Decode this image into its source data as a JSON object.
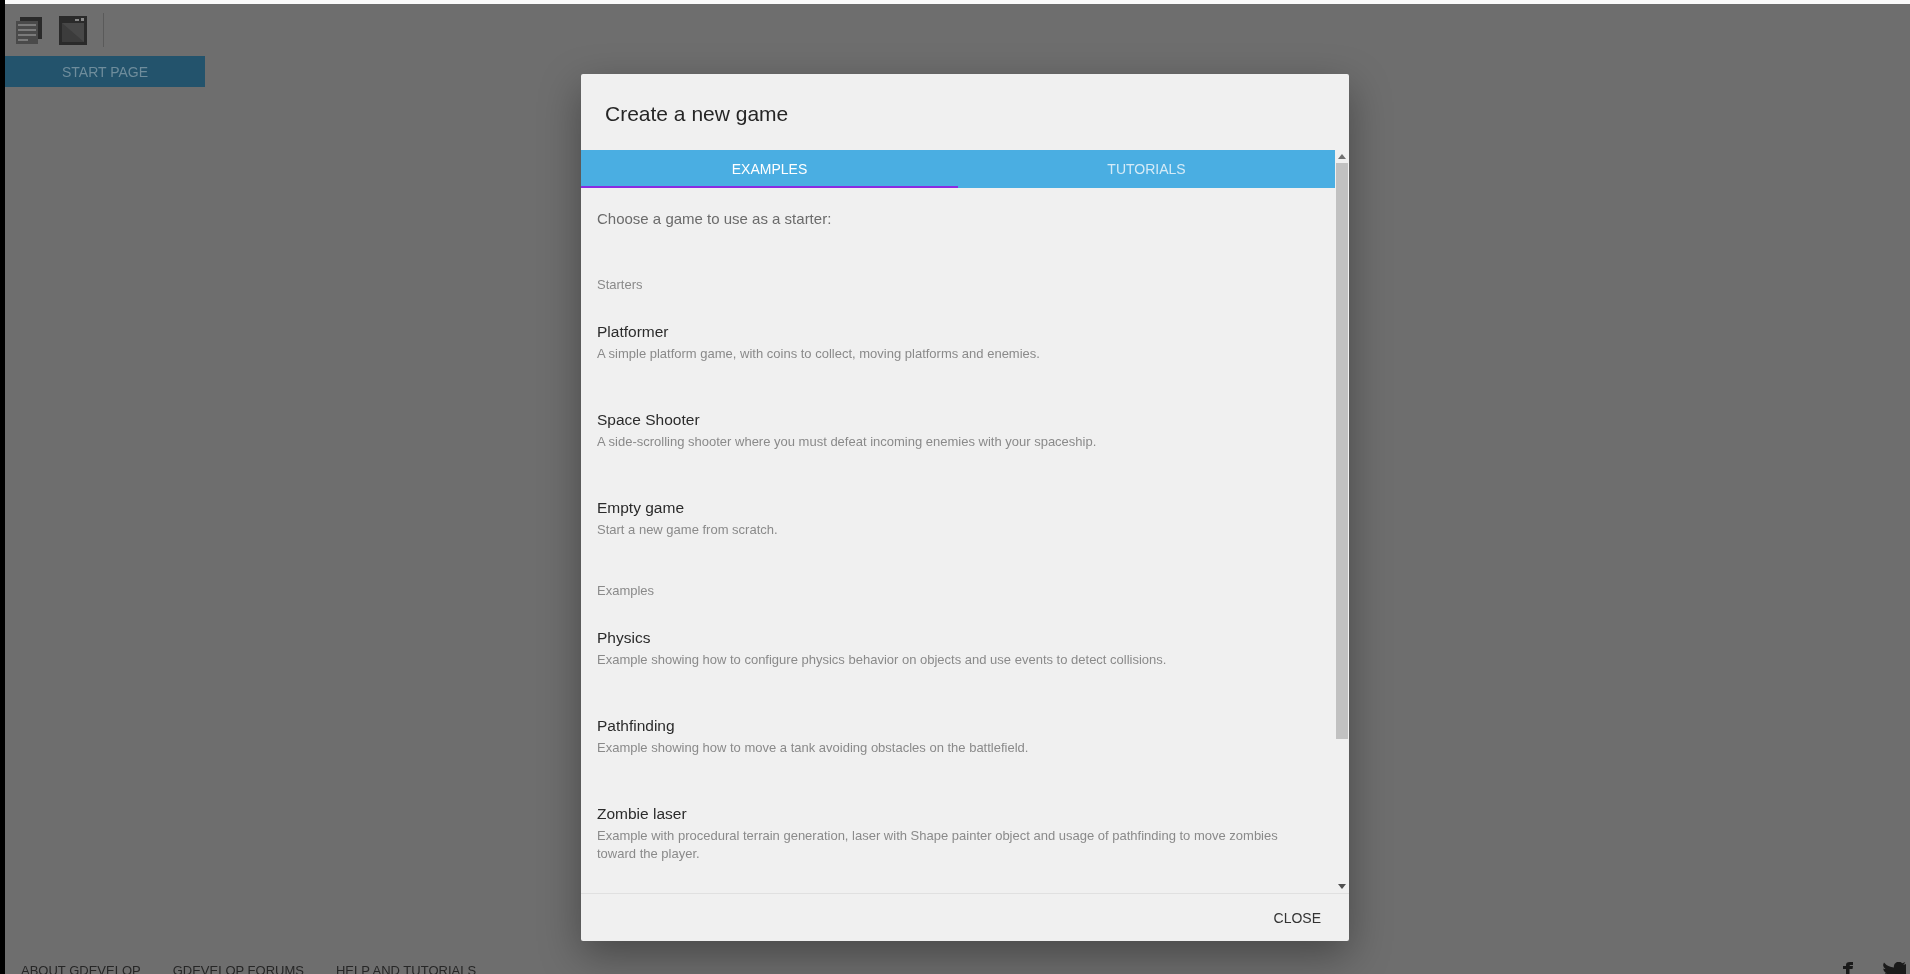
{
  "toolbar": {
    "tabs": [
      {
        "label": "START PAGE",
        "selected": true
      }
    ]
  },
  "dialog": {
    "title": "Create a new game",
    "tabs": [
      {
        "label": "EXAMPLES",
        "selected": true
      },
      {
        "label": "TUTORIALS",
        "selected": false
      }
    ],
    "intro": "Choose a game to use as a starter:",
    "sections": [
      {
        "header": "Starters",
        "items": [
          {
            "title": "Platformer",
            "description": "A simple platform game, with coins to collect, moving platforms and enemies."
          },
          {
            "title": "Space Shooter",
            "description": "A side-scrolling shooter where you must defeat incoming enemies with your spaceship."
          },
          {
            "title": "Empty game",
            "description": "Start a new game from scratch."
          }
        ]
      },
      {
        "header": "Examples",
        "items": [
          {
            "title": "Physics",
            "description": "Example showing how to configure physics behavior on objects and use events to detect collisions."
          },
          {
            "title": "Pathfinding",
            "description": "Example showing how to move a tank avoiding obstacles on the battlefield."
          },
          {
            "title": "Zombie laser",
            "description": "Example with procedural terrain generation, laser with Shape painter object and usage of pathfinding to move zombies toward the player."
          }
        ]
      }
    ],
    "buttons": [
      "CLOSE"
    ]
  },
  "footer": {
    "links": [
      "ABOUT GDEVELOP",
      "GDEVELOP FORUMS",
      "HELP AND TUTORIALS"
    ]
  }
}
